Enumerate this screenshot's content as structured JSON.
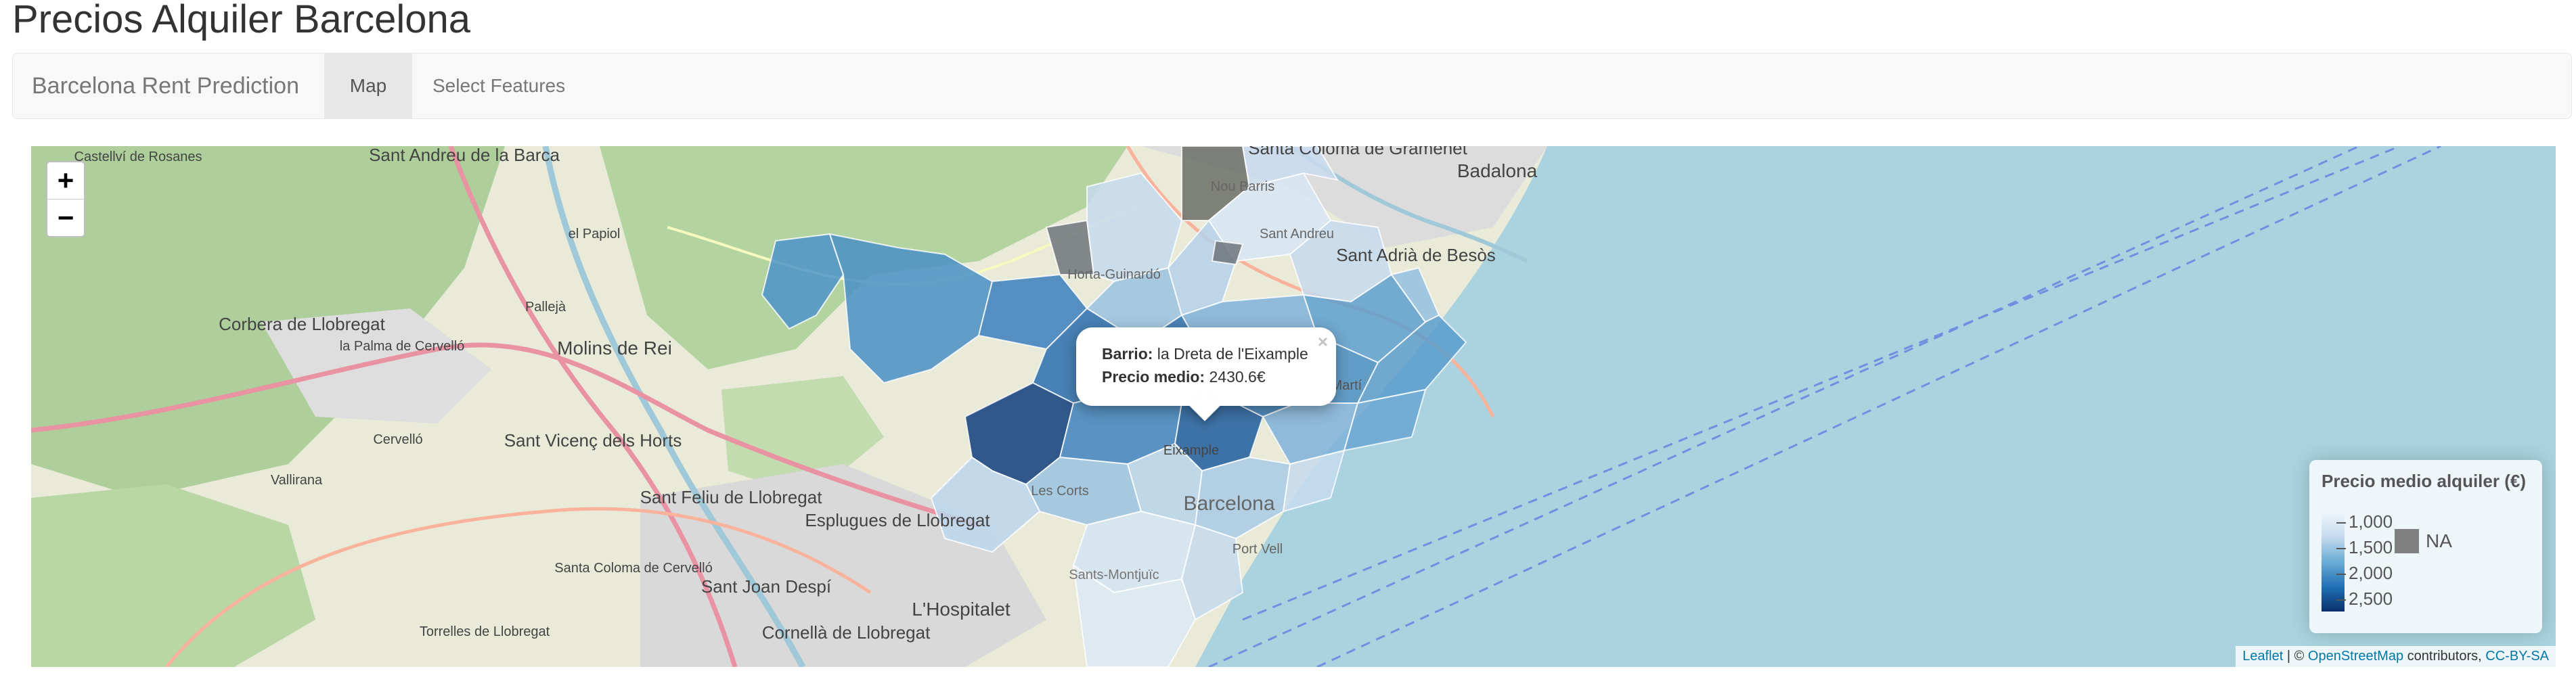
{
  "page": {
    "title": "Precios Alquiler Barcelona"
  },
  "navbar": {
    "brand": "Barcelona Rent Prediction",
    "tabs": [
      {
        "label": "Map",
        "active": true
      },
      {
        "label": "Select Features",
        "active": false
      }
    ]
  },
  "map": {
    "zoom_in": "+",
    "zoom_out": "−",
    "place_labels": [
      "Castellví de Rosanes",
      "Sant Andreu de la Barca",
      "Santa Coloma de Gramenet",
      "Badalona",
      "el Papiol",
      "Sant Adrià de Besòs",
      "Corbera de Llobregat",
      "Pallejà",
      "Molins de Rei",
      "la Palma de Cervelló",
      "Cervelló",
      "Sant Vicenç dels Horts",
      "Vallirana",
      "Sant Feliu de Llobregat",
      "Esplugues de Llobregat",
      "Santa Coloma de Cervelló",
      "Sant Joan Despí",
      "Torrelles de Llobregat",
      "Cornellà de Llobregat",
      "L'Hospitalet",
      "Barcelona",
      "Horta-Guinardó",
      "Nou Barris",
      "Sant Andreu",
      "Sant Martí",
      "Eixample",
      "Les Corts",
      "Sants-Montjuïc",
      "Port Vell"
    ],
    "popup": {
      "label_barrio": "Barrio:",
      "value_barrio": "la Dreta de l'Eixample",
      "label_price": "Precio medio:",
      "value_price": "2430.6€",
      "close": "×"
    },
    "legend": {
      "title": "Precio medio alquiler (€)",
      "labels": [
        "1,000",
        "1,500",
        "2,000",
        "2,500"
      ],
      "na_label": "NA",
      "colors": [
        "#f0f6fc",
        "#c6dbef",
        "#6baed6",
        "#2171b5",
        "#08306b"
      ],
      "na_color": "#808080"
    },
    "attribution": {
      "leaflet": "Leaflet",
      "separator": " | © ",
      "osm": "OpenStreetMap",
      "contributors": " contributors, ",
      "license": "CC-BY-SA"
    },
    "colors": {
      "sea": "#aad3df",
      "land": "#e8ead5",
      "forest": "#a9cf9b",
      "urban": "#dcdcdc",
      "roads": "#e892a2"
    }
  }
}
